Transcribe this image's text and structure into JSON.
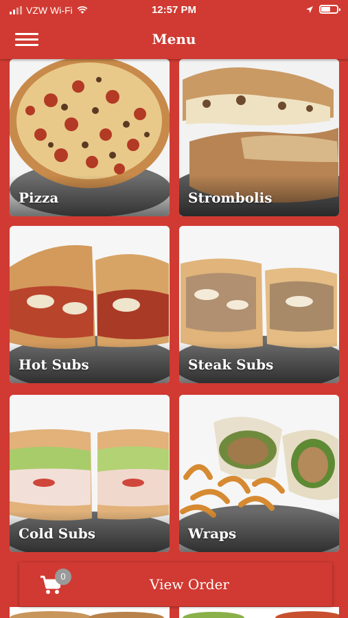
{
  "status_bar": {
    "carrier": "VZW Wi-Fi",
    "time": "12:57 PM"
  },
  "header": {
    "title": "Menu"
  },
  "menu_items": [
    {
      "label": "Pizza"
    },
    {
      "label": "Strombolis"
    },
    {
      "label": "Hot Subs"
    },
    {
      "label": "Steak Subs"
    },
    {
      "label": "Cold Subs"
    },
    {
      "label": "Wraps"
    }
  ],
  "order_bar": {
    "label": "View Order",
    "cart_count": "0"
  },
  "colors": {
    "brand_red": "#d03a32",
    "badge_gray": "#9a9a9a"
  }
}
